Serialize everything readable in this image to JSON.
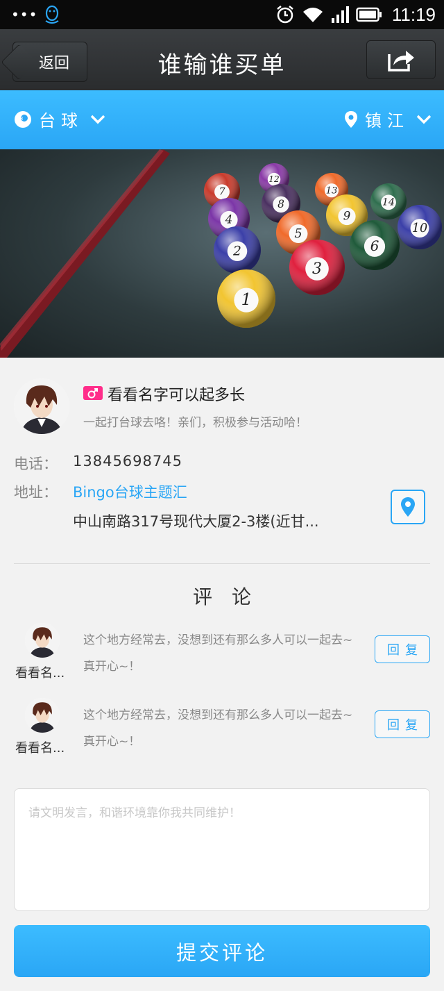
{
  "status_bar": {
    "dots": "•••",
    "time": "11:19"
  },
  "navbar": {
    "back_label": "返回",
    "title": "谁输谁买单"
  },
  "filter": {
    "category": "台球",
    "city": "镇江"
  },
  "banner": {
    "ball_numbers": [
      "1",
      "2",
      "3",
      "4",
      "5",
      "6",
      "7",
      "8",
      "9",
      "10",
      "12",
      "13",
      "14"
    ]
  },
  "profile": {
    "name": "看看名字可以起多长",
    "signature": "一起打台球去咯！亲们，积极参与活动哈！",
    "phone_label": "电话：",
    "phone": "13845698745",
    "address_label": "地址：",
    "venue": "Bingo台球主题汇",
    "address": "中山南路317号现代大厦2-3楼(近甘..."
  },
  "comments": {
    "title": "评论",
    "items": [
      {
        "user": "看看名...",
        "text": "这个地方经常去，没想到还有那么多人可以一起去~真开心~！",
        "reply_label": "回复"
      },
      {
        "user": "看看名...",
        "text": "这个地方经常去，没想到还有那么多人可以一起去~真开心~！",
        "reply_label": "回复"
      }
    ]
  },
  "comment_input": {
    "placeholder": "请文明发言，和谐环境靠你我共同维护！"
  },
  "submit_label": "提交评论",
  "colors": {
    "accent": "#2aa6f5",
    "navbar": "#2e3133",
    "gender_badge": "#ff2d8a"
  }
}
